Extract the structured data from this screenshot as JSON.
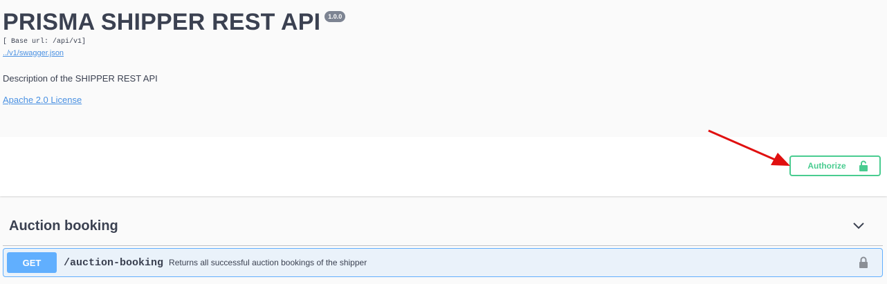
{
  "info": {
    "title": "PRISMA SHIPPER REST API",
    "version": "1.0.0",
    "base_url": "[ Base url: /api/v1]",
    "spec_link": "../v1/swagger.json",
    "description": "Description of the SHIPPER REST API",
    "license": "Apache 2.0 License"
  },
  "auth": {
    "button_label": "Authorize",
    "icon": "unlock-icon"
  },
  "tags": [
    {
      "name": "Auction booking",
      "operations": [
        {
          "method": "GET",
          "path": "/auction-booking",
          "summary": "Returns all successful auction bookings of the shipper",
          "icon": "lock-icon"
        }
      ]
    }
  ],
  "colors": {
    "get": "#61affe",
    "authorize": "#49cc90",
    "link": "#4990e2",
    "annotation_arrow": "#e01010"
  }
}
